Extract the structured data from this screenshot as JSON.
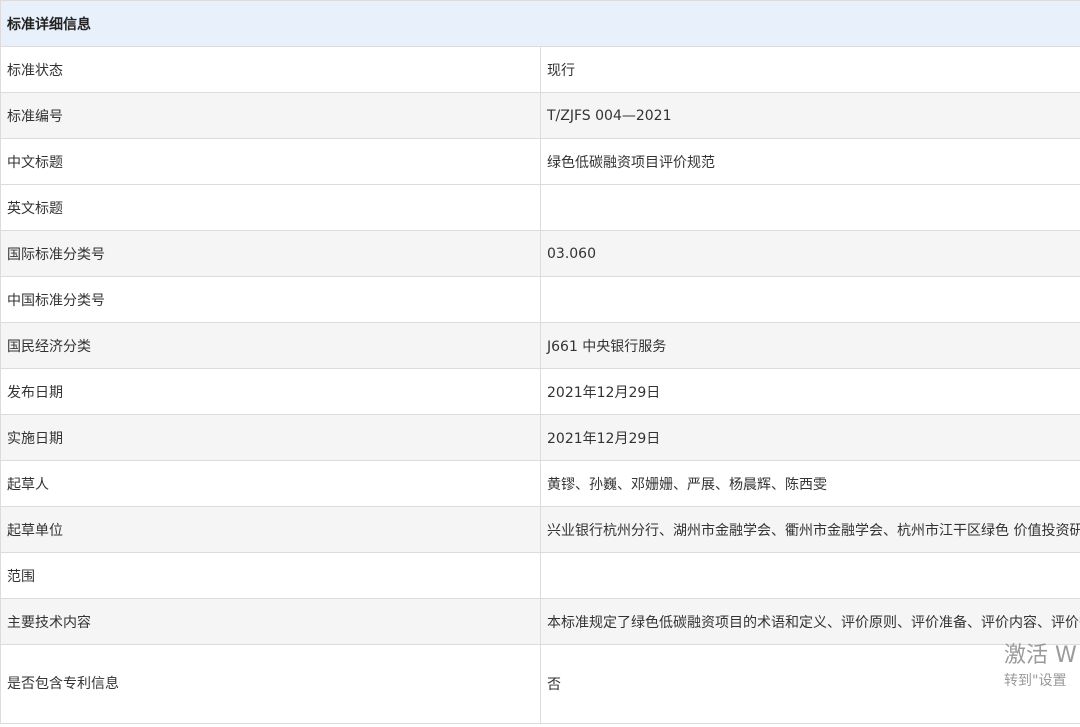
{
  "header": {
    "title": "标准详细信息"
  },
  "rows": [
    {
      "label": "标准状态",
      "value": "现行"
    },
    {
      "label": "标准编号",
      "value": "T/ZJFS 004—2021"
    },
    {
      "label": "中文标题",
      "value": "绿色低碳融资项目评价规范"
    },
    {
      "label": "英文标题",
      "value": ""
    },
    {
      "label": "国际标准分类号",
      "value": "03.060"
    },
    {
      "label": "中国标准分类号",
      "value": ""
    },
    {
      "label": "国民经济分类",
      "value": "J661 中央银行服务"
    },
    {
      "label": "发布日期",
      "value": "2021年12月29日"
    },
    {
      "label": "实施日期",
      "value": "2021年12月29日"
    },
    {
      "label": "起草人",
      "value": "黄镠、孙巍、邓姗姗、严展、杨晨辉、陈西雯"
    },
    {
      "label": "起草单位",
      "value": "兴业银行杭州分行、湖州市金融学会、衢州市金融学会、杭州市江干区绿色 价值投资研究中心"
    },
    {
      "label": "范围",
      "value": ""
    },
    {
      "label": "主要技术内容",
      "value": "本标准规定了绿色低碳融资项目的术语和定义、评价原则、评价准备、评价内容、评价等级、评价结果及改进。"
    },
    {
      "label": "是否包含专利信息",
      "value": "否"
    }
  ],
  "watermark": {
    "line1": "激活 W",
    "line2": "转到\"设置"
  },
  "colors": {
    "header_bg": "#e8f0fb",
    "stripe_bg": "#f5f5f5",
    "border": "#dcdcdc",
    "text": "#333333"
  }
}
